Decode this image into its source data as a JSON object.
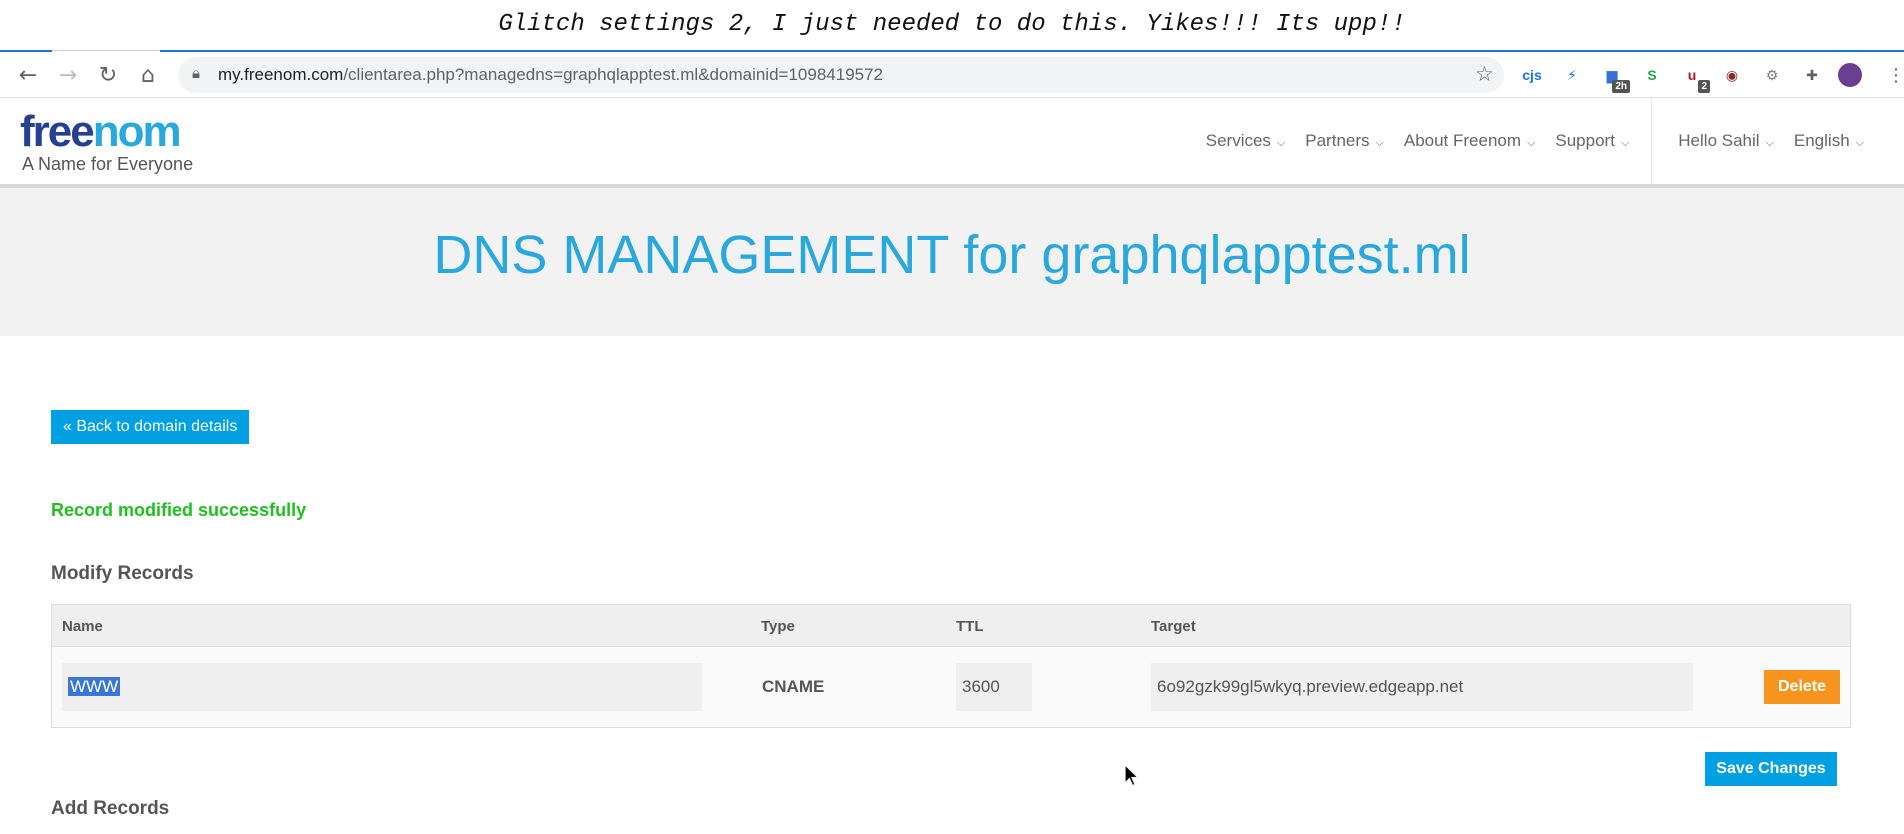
{
  "caption": "Glitch settings 2, I just needed to do this. Yikes!!! Its upp!!",
  "browser": {
    "url_host": "my.freenom.com",
    "url_path": "/clientarea.php?managedns=graphqlapptest.ml&domainid=1098419572",
    "extensions": [
      {
        "name": "cjs",
        "label": "cjs",
        "color": "#1a73e8"
      },
      {
        "name": "bolt",
        "label": "⚡",
        "color": "#1a73e8"
      },
      {
        "name": "tabs",
        "label": "▆",
        "color": "#3b6fd8",
        "badge": "2h"
      },
      {
        "name": "s-ext",
        "label": "S",
        "color": "#2aa845"
      },
      {
        "name": "ublock",
        "label": "u",
        "color": "#b0171f",
        "badge": "2"
      },
      {
        "name": "mask",
        "label": "◉",
        "color": "#8a2c2c"
      },
      {
        "name": "gear",
        "label": "⚙",
        "color": "#777"
      },
      {
        "name": "puzzle",
        "label": "✚",
        "color": "#5f6368"
      }
    ]
  },
  "site": {
    "logo_free": "free",
    "logo_nom": "nom",
    "tagline": "A Name for Everyone",
    "nav": [
      "Services",
      "Partners",
      "About Freenom",
      "Support"
    ],
    "user_nav": [
      "Hello Sahil",
      "English"
    ]
  },
  "page": {
    "title": "DNS MANAGEMENT for graphqlapptest.ml",
    "back_label": "« Back to domain details",
    "success_message": "Record modified successfully",
    "modify_heading": "Modify Records",
    "add_heading": "Add Records",
    "save_label": "Save Changes"
  },
  "records_table": {
    "headers": [
      "Name",
      "Type",
      "TTL",
      "Target"
    ],
    "row": {
      "name": "WWW",
      "type": "CNAME",
      "ttl": "3600",
      "target": "6o92gzk99gl5wkyq.preview.edgeapp.net",
      "delete_label": "Delete"
    }
  },
  "colors": {
    "brand_blue": "#29a8df",
    "button_blue": "#00a0e3",
    "delete_orange": "#f7941d",
    "success_green": "#1fbf1f"
  }
}
